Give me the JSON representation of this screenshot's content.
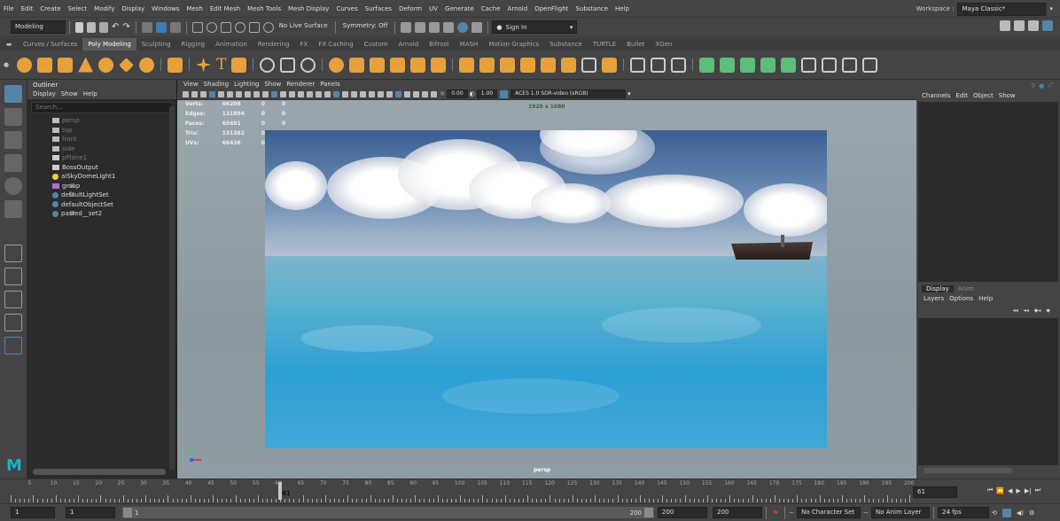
{
  "menubar": {
    "items": [
      "File",
      "Edit",
      "Create",
      "Select",
      "Modify",
      "Display",
      "Windows",
      "Mesh",
      "Edit Mesh",
      "Mesh Tools",
      "Mesh Display",
      "Curves",
      "Surfaces",
      "Deform",
      "UV",
      "Generate",
      "Cache",
      "Arnold",
      "OpenFlight",
      "Substance",
      "Help"
    ],
    "workspace_label": "Workspace :",
    "workspace_value": "Maya Classic*"
  },
  "statusline": {
    "menuset": "Modeling",
    "live_surface": "No Live Surface",
    "symmetry": "Symmetry: Off",
    "sign_in": "Sign In"
  },
  "shelf": {
    "tabs": [
      "Curves / Surfaces",
      "Poly Modeling",
      "Sculpting",
      "Rigging",
      "Animation",
      "Rendering",
      "FX",
      "FX Caching",
      "Custom",
      "Arnold",
      "Bifrost",
      "MASH",
      "Motion Graphics",
      "Substance",
      "TURTLE",
      "Bullet",
      "XGen"
    ],
    "active_tab": "Poly Modeling"
  },
  "outliner": {
    "title": "Outliner",
    "menu": [
      "Display",
      "Show",
      "Help"
    ],
    "search_placeholder": "Search...",
    "items": [
      {
        "label": "persp",
        "dim": true,
        "icon": "camera-icon"
      },
      {
        "label": "top",
        "dim": true,
        "icon": "camera-icon"
      },
      {
        "label": "front",
        "dim": true,
        "icon": "camera-icon"
      },
      {
        "label": "side",
        "dim": true,
        "icon": "camera-icon"
      },
      {
        "label": "pPlane1",
        "dim": true,
        "icon": "mesh-icon"
      },
      {
        "label": "BossOutput",
        "dim": false,
        "icon": "mesh-icon"
      },
      {
        "label": "aiSkyDomeLight1",
        "dim": false,
        "icon": "skydome-light-icon"
      },
      {
        "label": "group",
        "dim": false,
        "icon": "group-icon",
        "expander": "⊞"
      },
      {
        "label": "defaultLightSet",
        "dim": false,
        "icon": "set-icon",
        "expander": "⊞"
      },
      {
        "label": "defaultObjectSet",
        "dim": false,
        "icon": "set-icon"
      },
      {
        "label": "pasted__set2",
        "dim": false,
        "icon": "set-icon",
        "expander": "⊞"
      }
    ]
  },
  "viewport": {
    "menu": [
      "View",
      "Shading",
      "Lighting",
      "Show",
      "Renderer",
      "Panels"
    ],
    "exposure": "0.00",
    "gamma": "1.00",
    "color_space": "ACES 1.0 SDR-video (sRGB)",
    "resolution": "1920 x 1080",
    "camera": "persp",
    "hud": [
      {
        "label": "Verts:",
        "a": "66208",
        "b": "0",
        "c": "0"
      },
      {
        "label": "Edges:",
        "a": "131894",
        "b": "0",
        "c": "0"
      },
      {
        "label": "Faces:",
        "a": "65691",
        "b": "0",
        "c": "0"
      },
      {
        "label": "Tris:",
        "a": "131382",
        "b": "0",
        "c": "0"
      },
      {
        "label": "UVs:",
        "a": "66436",
        "b": "0",
        "c": "0"
      }
    ]
  },
  "channels": {
    "menu": [
      "Channels",
      "Edit",
      "Object",
      "Show"
    ],
    "layer_tabs": [
      "Display",
      "Anim"
    ],
    "layer_menu": [
      "Layers",
      "Options",
      "Help"
    ]
  },
  "timeline": {
    "ticks": [
      "5",
      "10",
      "15",
      "20",
      "25",
      "30",
      "35",
      "40",
      "45",
      "50",
      "55",
      "60",
      "65",
      "70",
      "75",
      "80",
      "85",
      "90",
      "95",
      "100",
      "105",
      "110",
      "115",
      "120",
      "125",
      "130",
      "135",
      "140",
      "145",
      "150",
      "155",
      "160",
      "165",
      "170",
      "175",
      "180",
      "185",
      "190",
      "195",
      "200"
    ],
    "current_frame": "61",
    "current_frame_field": "61"
  },
  "range": {
    "start": "1",
    "anim_start": "1",
    "range_start": "1",
    "range_end": "200",
    "anim_end": "200",
    "end": "200",
    "character_set": "No Character Set",
    "anim_layer": "No Anim Layer",
    "fps": "24 fps"
  },
  "colors": {
    "accent": "#5285a6",
    "maya_logo": "#1ab0c8",
    "shelf_orange": "#e8a13a",
    "shelf_green": "#5bbf7a"
  }
}
